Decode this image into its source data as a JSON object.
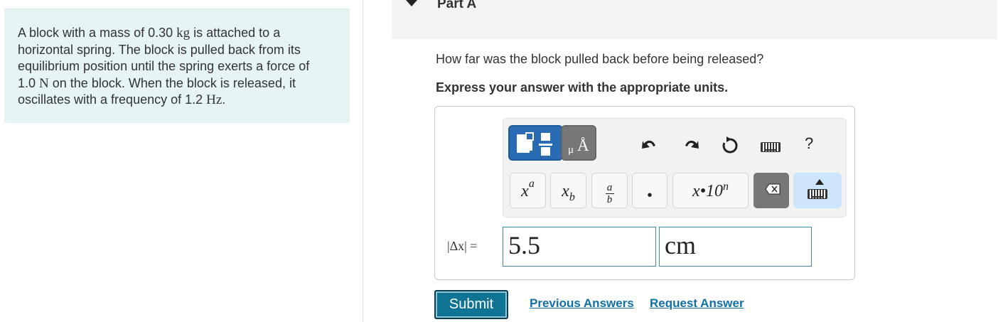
{
  "problem": {
    "line1_pre": "A block with a mass of 0.30 ",
    "mass_unit": "kg",
    "line1_post": " is attached to a",
    "line2": "horizontal spring. The block is pulled back from its",
    "line3": "equilibrium position until the spring exerts a force of",
    "line4_pre": "1.0 ",
    "force_unit": "N",
    "line4_post": " on the block. When the block is released, it",
    "line5_pre": "oscillates with a frequency of 1.2 ",
    "freq_unit": "Hz",
    "line5_post": "."
  },
  "part": {
    "title": "Part A"
  },
  "question": "How far was the block pulled back before being released?",
  "instruction": "Express your answer with the appropriate units.",
  "toolbar": {
    "units_mu": "μ",
    "units_angstrom": "Å",
    "undo_icon": "↶",
    "redo_icon": "↷",
    "reset_icon": "↻",
    "help": "?",
    "keys": {
      "superscript_base": "x",
      "superscript_exp": "a",
      "subscript_base": "x",
      "subscript_sub": "b",
      "fraction_num": "a",
      "fraction_den": "b",
      "dot": "•",
      "sci_notation": "x•10",
      "sci_exp": "n",
      "backspace": "⌫"
    }
  },
  "answer": {
    "label": "|Δx| =",
    "value": "5.5",
    "unit": "cm"
  },
  "actions": {
    "submit": "Submit",
    "previous_answers": "Previous Answers",
    "request_answer": "Request Answer"
  },
  "colors": {
    "problem_bg": "#e6f4f5",
    "submit_bg": "#0f7494",
    "link": "#1070a6",
    "template_button": "#2a6cb3",
    "input_border": "#3c8aa7"
  }
}
